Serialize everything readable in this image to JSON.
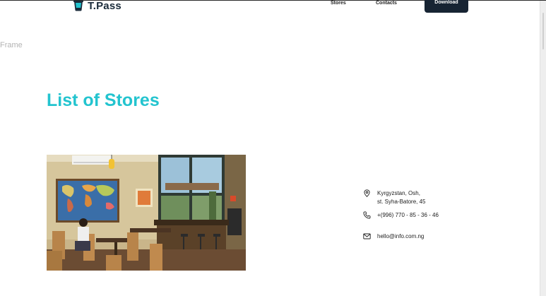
{
  "header": {
    "brand": "T.Pass",
    "nav": {
      "stores": "Stores",
      "contacts": "Contacts"
    },
    "download_label": "Download"
  },
  "canvas": {
    "frame_label": "Frame"
  },
  "main": {
    "title": "List of Stores"
  },
  "store": {
    "address_line1": "Kyrgyzstan, Osh,",
    "address_line2": "st. Syha-Batore, 45",
    "phone": "+(996) 770 - 85 - 36 - 46",
    "email": "hello@info.com.ng"
  },
  "icons": {
    "brand": "cup-logo-icon",
    "address": "location-pin-icon",
    "phone": "phone-icon",
    "email": "mail-icon"
  },
  "colors": {
    "accent": "#23c4cf",
    "button_bg": "#172433",
    "brand_text": "#1a2b3a"
  }
}
